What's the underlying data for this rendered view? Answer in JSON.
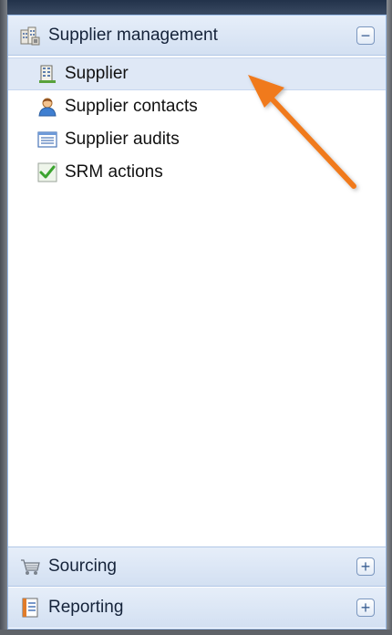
{
  "sections": {
    "supplier_management": {
      "title": "Supplier management",
      "toggle": "−",
      "icon": "building-icon",
      "items": [
        {
          "label": "Supplier",
          "icon": "building-icon",
          "selected": true
        },
        {
          "label": "Supplier contacts",
          "icon": "person-icon",
          "selected": false
        },
        {
          "label": "Supplier audits",
          "icon": "list-icon",
          "selected": false
        },
        {
          "label": "SRM actions",
          "icon": "checkmark-icon",
          "selected": false
        }
      ]
    },
    "sourcing": {
      "title": "Sourcing",
      "toggle": "+",
      "icon": "cart-icon"
    },
    "reporting": {
      "title": "Reporting",
      "toggle": "+",
      "icon": "report-icon"
    }
  },
  "colors": {
    "header_bg": "#d3e0f2",
    "selected_bg": "#dfe8f6",
    "border": "#99bbe8",
    "arrow": "#f07a1e"
  }
}
